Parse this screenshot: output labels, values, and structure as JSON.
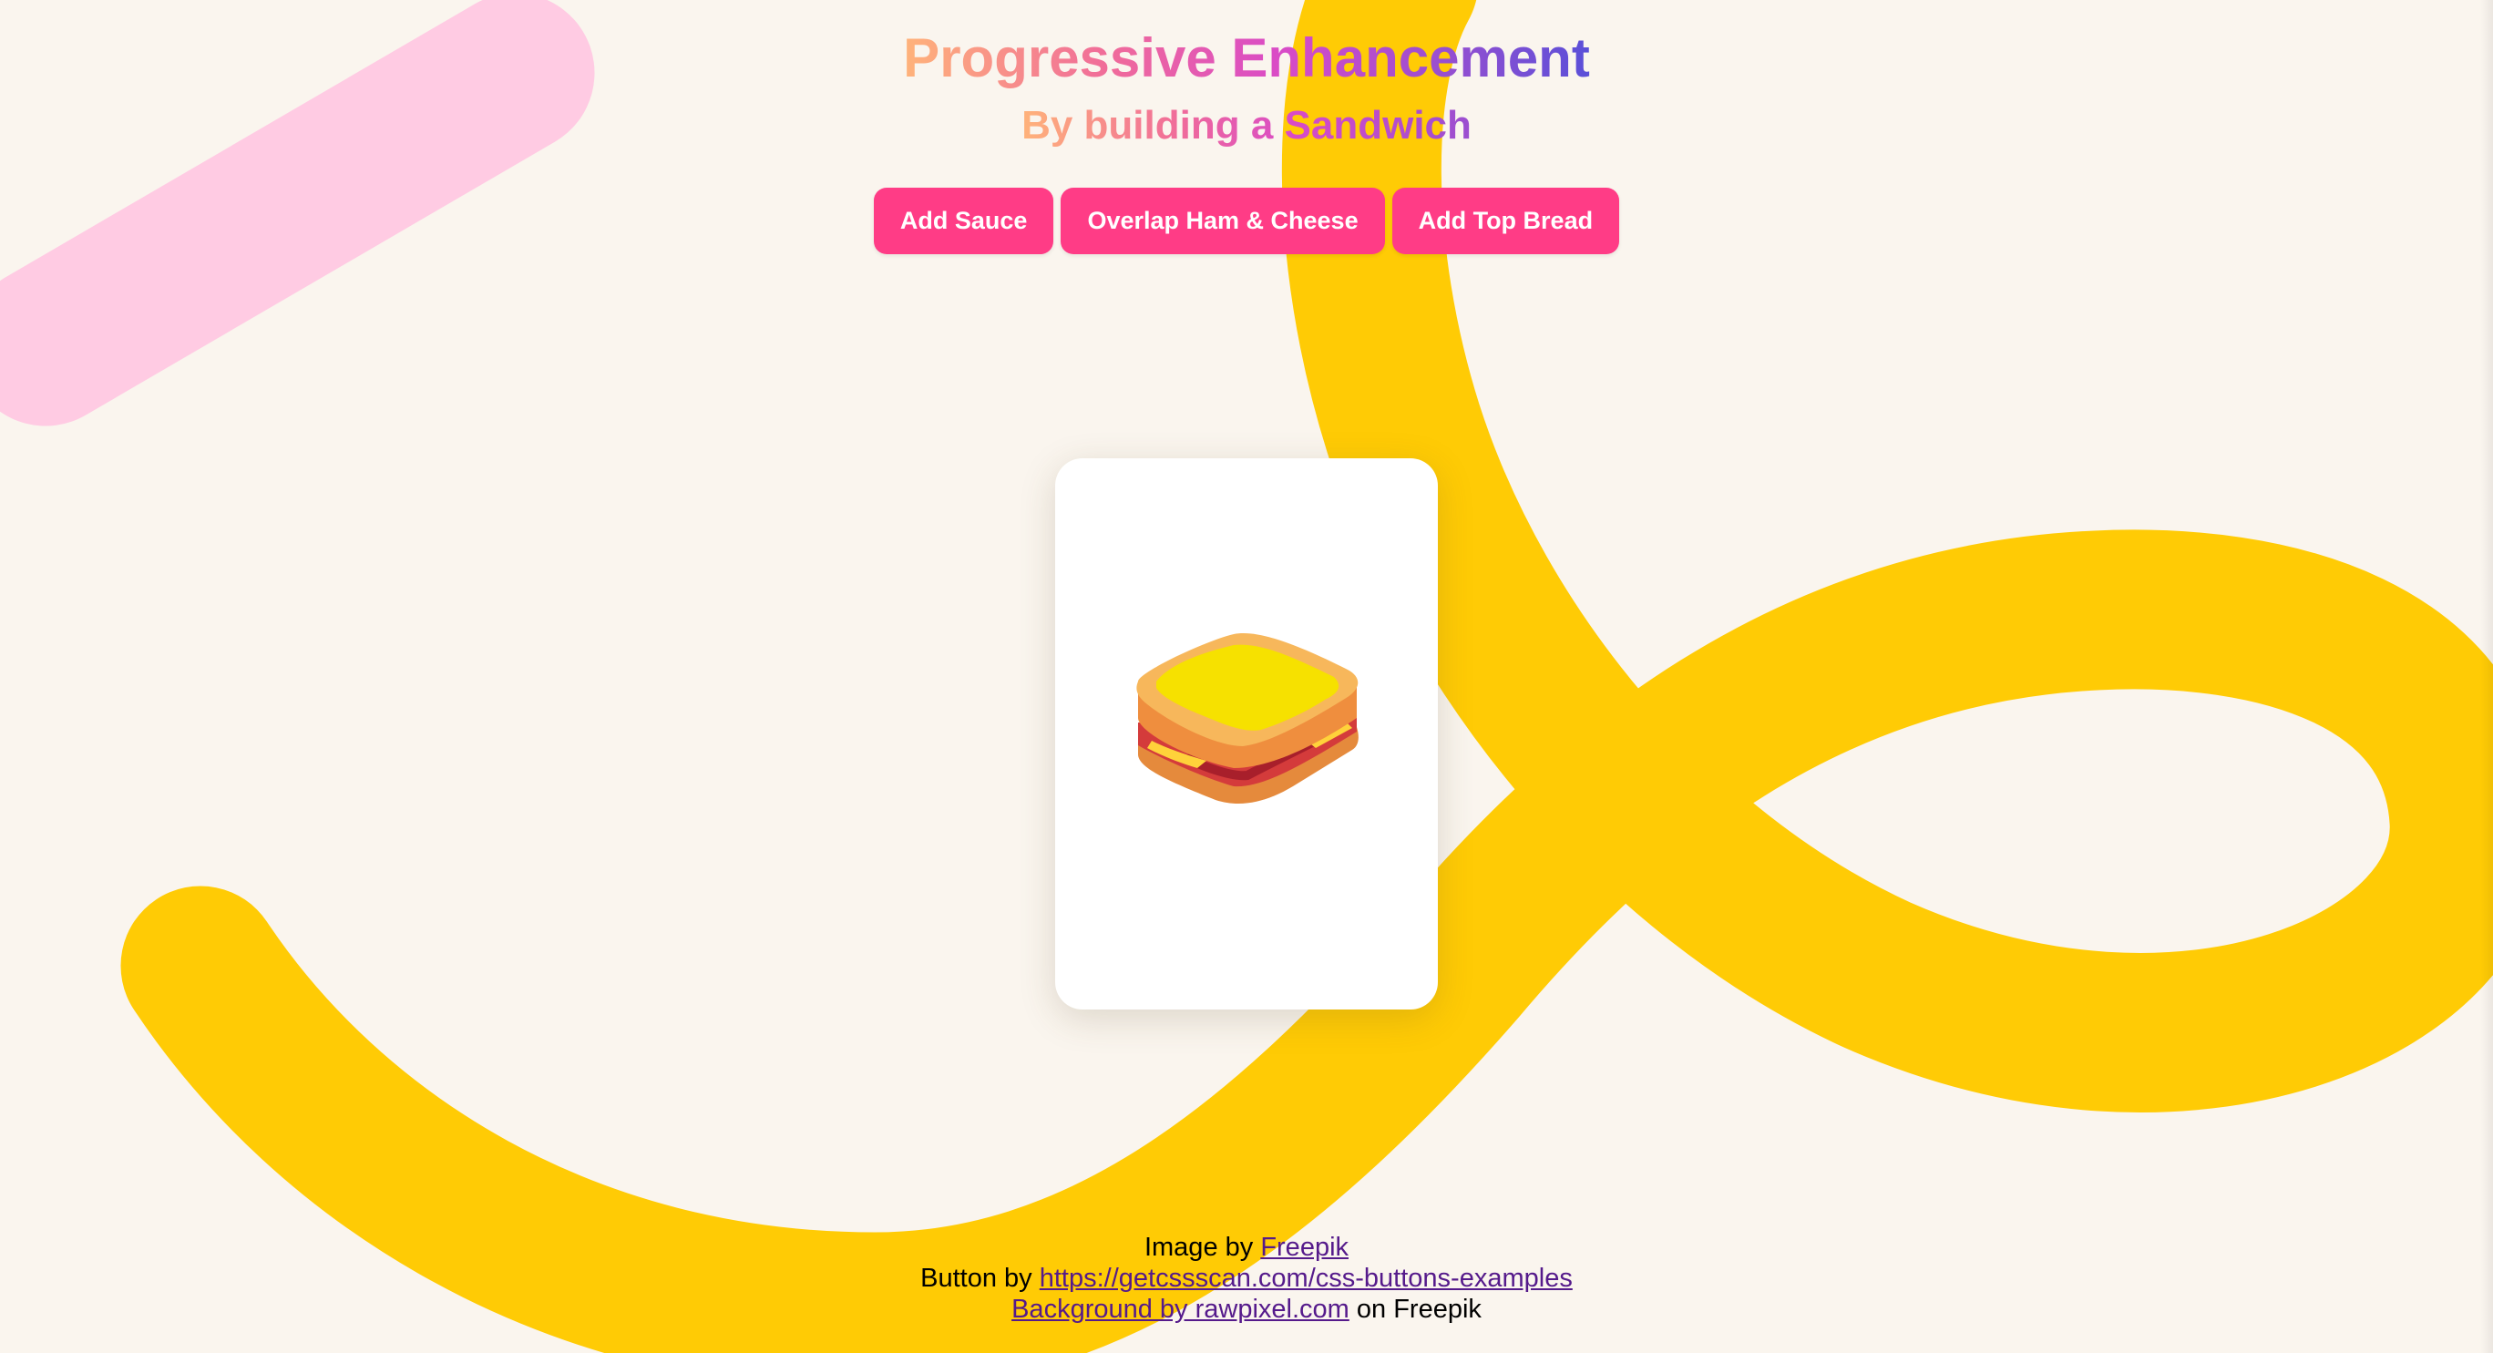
{
  "header": {
    "title": "Progressive Enhancement",
    "subtitle": "By building a Sandwich"
  },
  "actions": {
    "add_sauce": "Add Sauce",
    "overlap_ham_cheese": "Overlap Ham & Cheese",
    "add_top_bread": "Add Top Bread"
  },
  "card": {
    "image_icon": "sandwich-icon"
  },
  "credits": {
    "line1_prefix": "Image by ",
    "line1_link": "Freepik",
    "line2_prefix": "Button by ",
    "line2_link": "https://getcssscan.com/css-buttons-examples",
    "line3_link": "Background by rawpixel.com",
    "line3_suffix": " on Freepik"
  },
  "colors": {
    "background": "#faf5ee",
    "button": "#ff3c86",
    "swirl_yellow": "#ffcb05",
    "swirl_pink": "#ffcbe3",
    "link": "#551a8b"
  }
}
